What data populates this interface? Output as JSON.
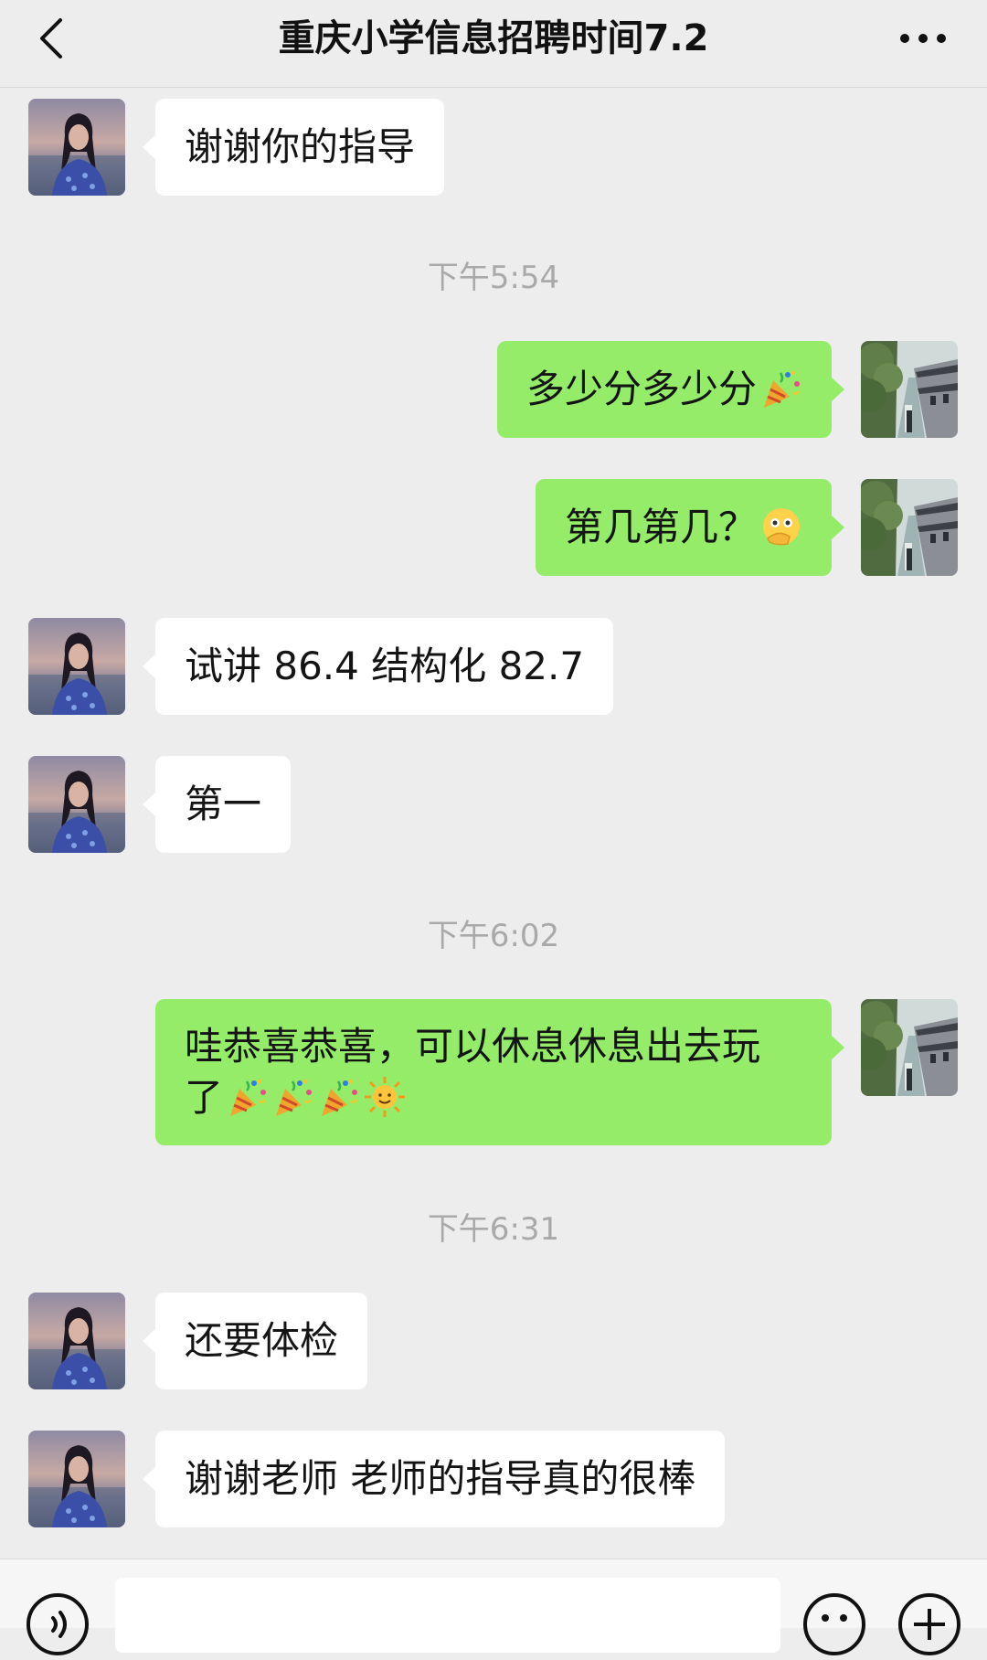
{
  "header": {
    "title": "重庆小学信息招聘时间7.2",
    "back_icon": "chevron-left-icon",
    "more_icon": "more-dots-icon"
  },
  "messages": [
    {
      "side": "in",
      "text": "谢谢你的指导"
    },
    {
      "type": "timestamp",
      "text": "下午5:54"
    },
    {
      "side": "out",
      "text": "多少分多少分",
      "emojis": [
        "party-popper-emoji"
      ]
    },
    {
      "side": "out",
      "text": "第几第几？",
      "emojis": [
        "hand-over-mouth-emoji"
      ]
    },
    {
      "side": "in",
      "text": "试讲 86.4 结构化 82.7"
    },
    {
      "side": "in",
      "text": "第一"
    },
    {
      "type": "timestamp",
      "text": "下午6:02"
    },
    {
      "side": "out",
      "text_line1": "哇恭喜恭喜，可以休息休息出去玩",
      "text_line2": "了",
      "emojis": [
        "party-popper-emoji",
        "party-popper-emoji",
        "party-popper-emoji",
        "sun-emoji"
      ]
    },
    {
      "type": "timestamp",
      "text": "下午6:31"
    },
    {
      "side": "in",
      "text": "还要体检"
    },
    {
      "side": "in",
      "text": "谢谢老师 老师的指导真的很棒"
    }
  ],
  "input_bar": {
    "voice_icon": "voice-icon",
    "emoji_icon": "emoji-icon",
    "plus_icon": "plus-icon",
    "input_value": ""
  },
  "colors": {
    "background": "#ededed",
    "incoming_bubble": "#ffffff",
    "outgoing_bubble": "#95ec69",
    "timestamp_text": "#a9a9a9"
  }
}
